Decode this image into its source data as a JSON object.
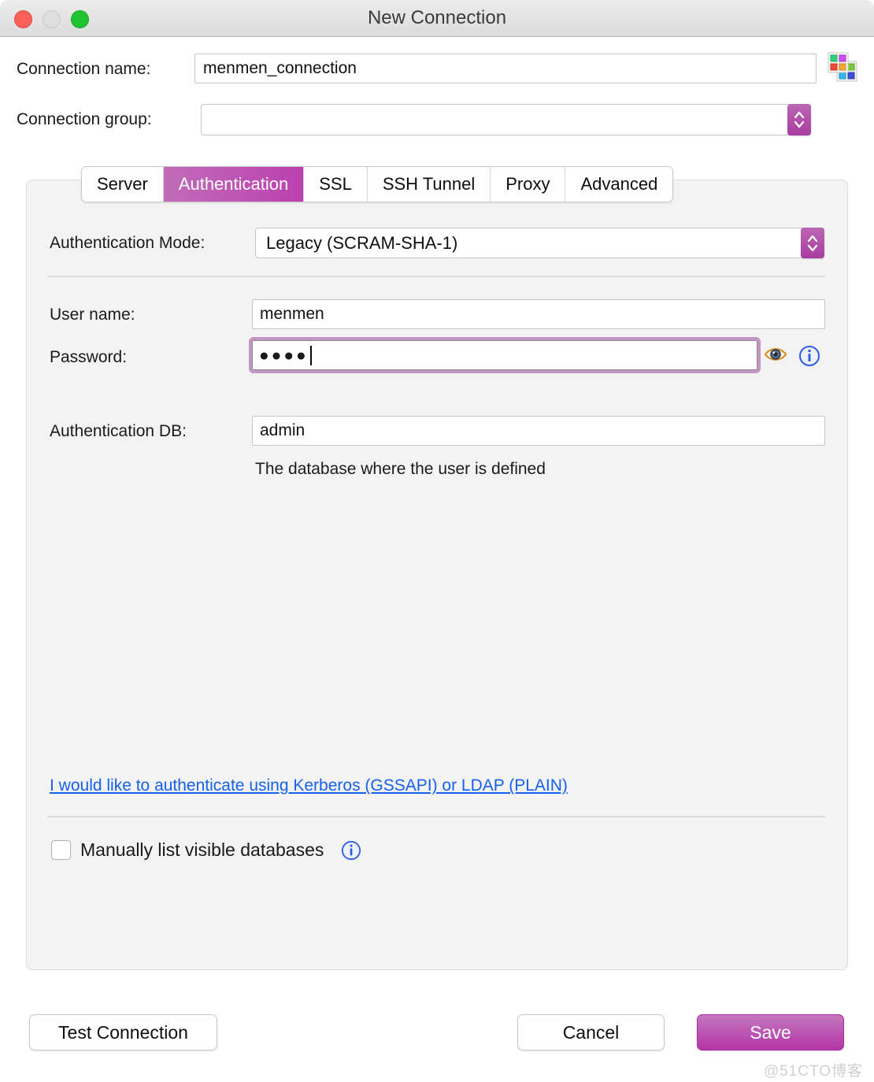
{
  "window": {
    "title": "New Connection",
    "traffic_lights": [
      "close",
      "minimize",
      "maximize"
    ]
  },
  "top_form": {
    "connection_name_label": "Connection name:",
    "connection_name_value": "menmen_connection",
    "connection_name_placeholder": "",
    "palette_icon": "color-palette-icon",
    "connection_group_label": "Connection group:",
    "connection_group_value": "",
    "connection_group_placeholder": ""
  },
  "tabs": [
    {
      "label": "Server",
      "active": false
    },
    {
      "label": "Authentication",
      "active": true
    },
    {
      "label": "SSL",
      "active": false
    },
    {
      "label": "SSH Tunnel",
      "active": false
    },
    {
      "label": "Proxy",
      "active": false
    },
    {
      "label": "Advanced",
      "active": false
    }
  ],
  "auth_panel": {
    "auth_mode_label": "Authentication Mode:",
    "auth_mode_value": "Legacy (SCRAM-SHA-1)",
    "username_label": "User name:",
    "username_value": "menmen",
    "password_label": "Password:",
    "password_masked": "●●●●",
    "password_length": 4,
    "show_password_icon": "eye-icon",
    "password_info_icon": "info-icon",
    "authdb_label": "Authentication DB:",
    "authdb_value": "admin",
    "authdb_hint": "The database where the user is defined",
    "kerberos_link": "I would like to authenticate using Kerberos (GSSAPI) or LDAP (PLAIN)",
    "manual_list_checkbox_label": "Manually list visible databases",
    "manual_list_checked": false,
    "manual_list_info_icon": "info-icon"
  },
  "footer": {
    "test_connection_label": "Test Connection",
    "cancel_label": "Cancel",
    "save_label": "Save"
  },
  "watermark": "@51CTO博客",
  "colors": {
    "accent": "#b335a6",
    "accent_light": "#c477be",
    "focus_ring": "#c295c2",
    "link": "#1560f0",
    "panel_bg": "#f3f3f3",
    "titlebar_bg": "#e4e4e4",
    "close": "#fb6058",
    "minimize": "#dedede",
    "maximize": "#1fc430"
  }
}
